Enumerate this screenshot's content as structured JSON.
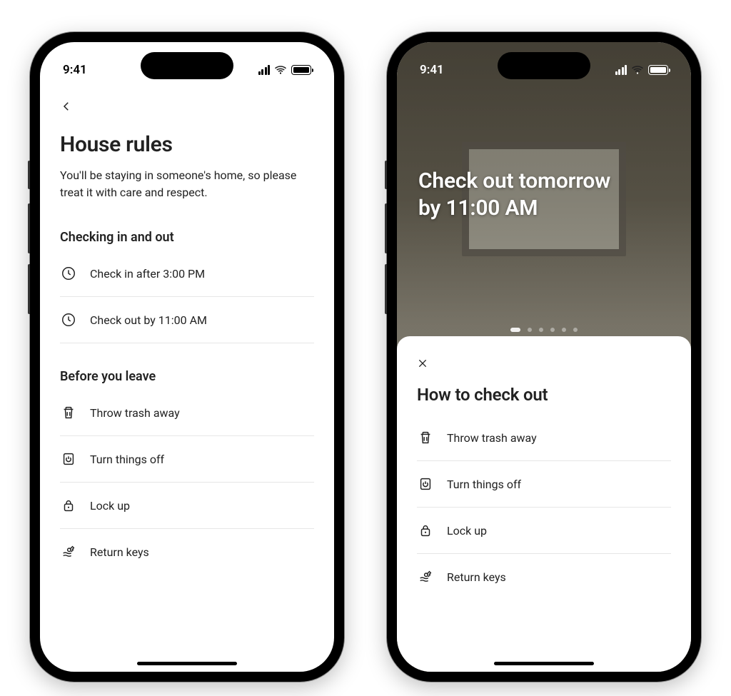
{
  "status": {
    "time": "9:41"
  },
  "left": {
    "title": "House rules",
    "subtitle": "You'll be staying in someone's home, so please treat it with care and respect.",
    "section1_head": "Checking in and out",
    "checkin": "Check in after 3:00 PM",
    "checkout": "Check out by 11:00 AM",
    "section2_head": "Before you leave",
    "items": {
      "trash": "Throw trash away",
      "off": "Turn things off",
      "lock": "Lock up",
      "keys": "Return keys"
    }
  },
  "right": {
    "hero_line1": "Check out tomorrow",
    "hero_line2": "by 11:00 AM",
    "sheet_title": "How to check out",
    "items": {
      "trash": "Throw trash away",
      "off": "Turn things off",
      "lock": "Lock up",
      "keys": "Return keys"
    }
  }
}
